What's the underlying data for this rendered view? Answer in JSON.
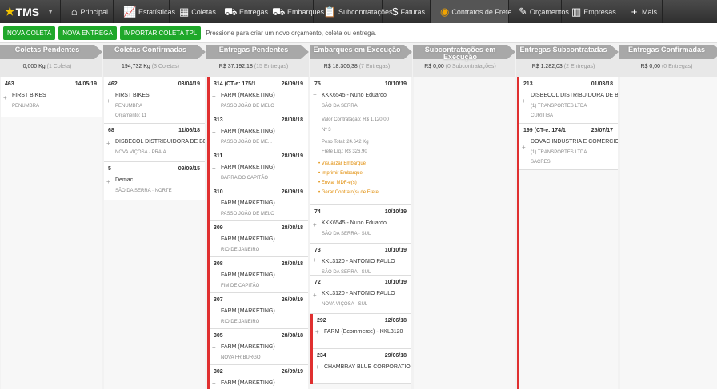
{
  "app": {
    "logo": "TMS"
  },
  "nav": [
    {
      "label": "Principal",
      "icon": "home-icon"
    },
    {
      "label": "Estatísticas",
      "icon": "chart-icon"
    },
    {
      "label": "Coletas",
      "icon": "boxes-icon"
    },
    {
      "label": "Entregas",
      "icon": "truck-icon"
    },
    {
      "label": "Embarques",
      "icon": "truck-icon"
    },
    {
      "label": "Subcontratações",
      "icon": "clipboard-icon"
    },
    {
      "label": "Faturas",
      "icon": "dollar-icon"
    },
    {
      "label": "Contratos de Frete",
      "icon": "coins-icon"
    },
    {
      "label": "Orçamentos",
      "icon": "quote-icon"
    },
    {
      "label": "Empresas",
      "icon": "building-icon"
    },
    {
      "label": "Mais",
      "icon": "plus-icon"
    }
  ],
  "toolbar": {
    "btn_nova_coleta": "NOVA COLETA",
    "btn_nova_entrega": "NOVA ENTREGA",
    "btn_importar": "IMPORTAR COLETA TPL",
    "hint": "Pressione para criar um novo orçamento, coleta ou entrega."
  },
  "columns": [
    {
      "title": "Coletas Pendentes",
      "value": "0,000 Kg",
      "suffix": "(1 Coleta)",
      "cards": [
        {
          "num": "463",
          "date": "14/05/19",
          "l1": "FIRST BIKES",
          "l2": "PENUMBRA"
        }
      ]
    },
    {
      "title": "Coletas Confirmadas",
      "value": "194,732 Kg",
      "suffix": "(3 Coletas)",
      "cards": [
        {
          "num": "462",
          "date": "03/04/19",
          "l1": "FIRST BIKES",
          "l2": "PENUMBRA",
          "l3": "Orçamento: 11"
        },
        {
          "num": "68",
          "date": "11/06/18",
          "l1": "DISBECOL DISTRIBUIDORA DE BEBID",
          "l2": "NOVA VIÇOSA · PRAIA"
        },
        {
          "num": "5",
          "date": "09/09/15",
          "l1": "Demac",
          "l2": "SÃO DA SERRA · NORTE"
        }
      ]
    },
    {
      "title": "Entregas Pendentes",
      "value": "R$ 37.192,18",
      "suffix": "(15 Entregas)",
      "cards": [
        {
          "num": "314 (CT-e: 175/1",
          "date": "26/09/19",
          "l1": "FARM (MARKETING)",
          "l2": "PASSO JOÃO DE MELO"
        },
        {
          "num": "313",
          "date": "28/08/18",
          "l1": "FARM (MARKETING)",
          "l2": "PASSO JOÃO DE ME..."
        },
        {
          "num": "311",
          "date": "28/09/19",
          "l1": "FARM (MARKETING)",
          "l2": "BARRA DO CAPITÃO"
        },
        {
          "num": "310",
          "date": "26/09/19",
          "l1": "FARM (MARKETING)",
          "l2": "PASSO JOÃO DE MELO"
        },
        {
          "num": "309",
          "date": "28/08/18",
          "l1": "FARM (MARKETING)",
          "l2": "RIO DE JANEIRO"
        },
        {
          "num": "308",
          "date": "28/08/18",
          "l1": "FARM (MARKETING)",
          "l2": "FIM DE CAPITÃO"
        },
        {
          "num": "307",
          "date": "26/09/19",
          "l1": "FARM (MARKETING)",
          "l2": "RIO DE JANEIRO"
        },
        {
          "num": "305",
          "date": "28/08/18",
          "l1": "FARM (MARKETING)",
          "l2": "NOVA FRIBURGO"
        },
        {
          "num": "302",
          "date": "26/09/19",
          "l1": "FARM (MARKETING)",
          "l2": ""
        }
      ]
    },
    {
      "title": "Embarques em Execução",
      "value": "R$ 18.306,38",
      "suffix": "(7 Entregas)",
      "expanded": {
        "num": "75",
        "date": "10/10/19",
        "l1": "KKK6545 - Nuno Eduardo",
        "l2": "SÃO DA SERRA",
        "valor": "Valor Contratação: R$ 1.120,00",
        "sub": "Nº 3",
        "peso": "Peso Total: 24.642 Kg",
        "frete": "Frete Líq.: R$ 326,90",
        "actions": [
          "Visualizar Embarque",
          "Imprimir Embarque",
          "Enviar MDF-e(s)",
          "Gerar Contrato(s) de Frete"
        ]
      },
      "cards": [
        {
          "num": "74",
          "date": "10/10/19",
          "l1": "KKK6545 - Nuno Eduardo",
          "l2": "SÃO DA SERRA · SUL"
        },
        {
          "num": "73",
          "date": "10/10/19",
          "l1": "KKL3120 - ANTONIO PAULO",
          "l2": "SÃO DA SERRA · SUL"
        },
        {
          "num": "72",
          "date": "10/10/19",
          "l1": "KKL3120 - ANTONIO PAULO",
          "l2": "NOVA VIÇOSA · SUL"
        }
      ],
      "red_cards": [
        {
          "num": "292",
          "date": "12/06/18",
          "l1": "FARM (Ecommerce) - KKL3120"
        },
        {
          "num": "234",
          "date": "29/06/18",
          "l1": "CHAMBRAY BLUE CORPORATION - KI"
        }
      ]
    },
    {
      "title": "Subcontratações em Execução",
      "value": "R$ 0,00",
      "suffix": "(0 Subcontratações)",
      "cards": []
    },
    {
      "title": "Entregas Subcontratadas",
      "value": "R$ 1.282,03",
      "suffix": "(2 Entregas)",
      "cards": [
        {
          "num": "213",
          "date": "01/03/18",
          "l1": "DISBECOL DISTRIBUIDORA DE BEBI",
          "l2": "(1) TRANSPORTES LTDA",
          "l3": "CURITIBA"
        },
        {
          "num": "199 (CT-e: 174/1",
          "date": "25/07/17",
          "l1": "DOVAC INDUSTRIA E COMERCIO LTD.",
          "l2": "(1) TRANSPORTES LTDA",
          "l3": "SACRES"
        }
      ]
    },
    {
      "title": "Entregas Confirmadas",
      "value": "R$ 0,00",
      "suffix": "(0 Entregas)",
      "cards": []
    }
  ],
  "colors": {
    "accent_green": "#1fa82a",
    "alert_red": "#e03030",
    "link_orange": "#e08a00"
  }
}
